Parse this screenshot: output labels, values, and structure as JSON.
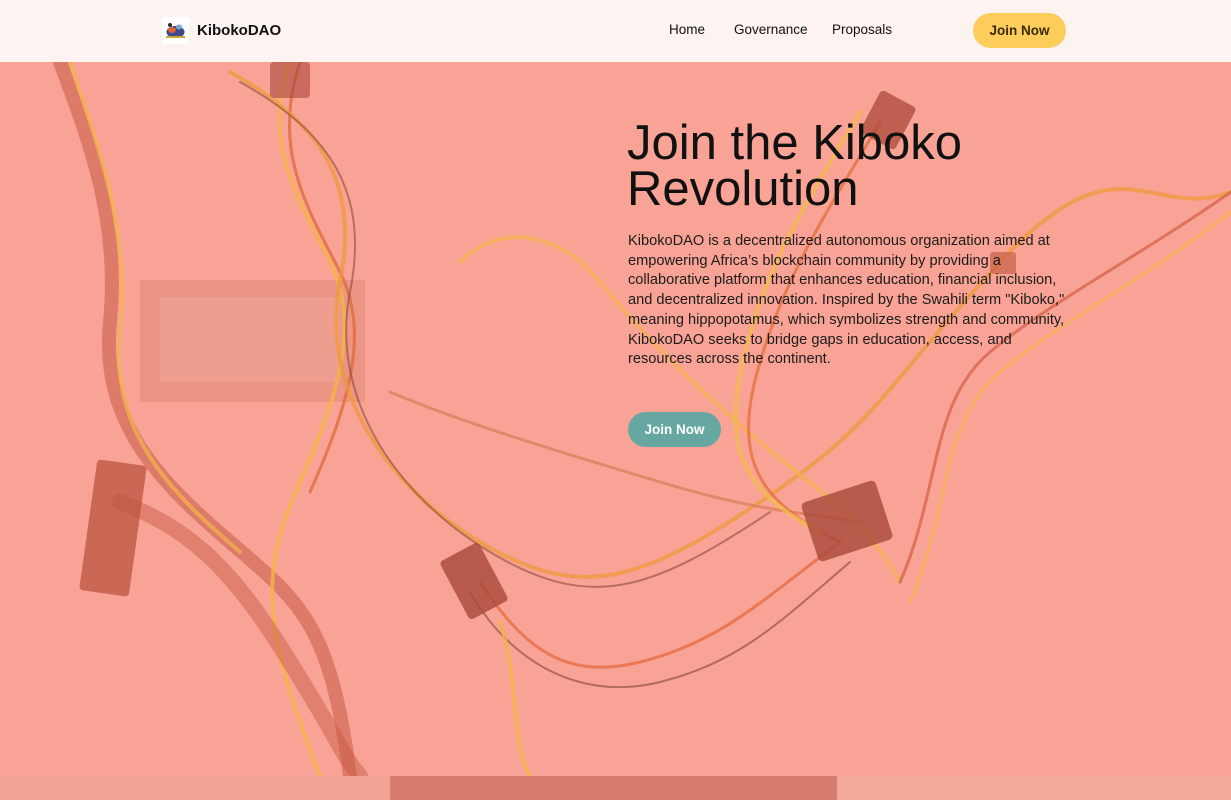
{
  "brand": {
    "name": "KibokoDAO",
    "logo_icon": "hippo-logo-icon"
  },
  "nav": {
    "links": [
      {
        "label": "Home"
      },
      {
        "label": "Governance"
      },
      {
        "label": "Proposals"
      }
    ],
    "cta_label": "Join Now"
  },
  "hero": {
    "title": "Join the Kiboko Revolution",
    "description": "KibokoDAO is a decentralized autonomous organization aimed at empowering Africa’s blockchain community by providing a collaborative platform that enhances education, financial inclusion, and decentralized innovation. Inspired by the Swahili term \"Kiboko,\" meaning hippopotamus, which symbolizes strength and community, KibokoDAO seeks to bridge gaps in education, access, and resources across the continent.",
    "cta_label": "Join Now",
    "background_image": "tangled computer power supply cables"
  },
  "colors": {
    "navbar_bg": "#fdf3f1",
    "hero_overlay": "#f9a396",
    "primary_cta": "#fdcd5b",
    "secondary_cta": "#66a8a1"
  }
}
